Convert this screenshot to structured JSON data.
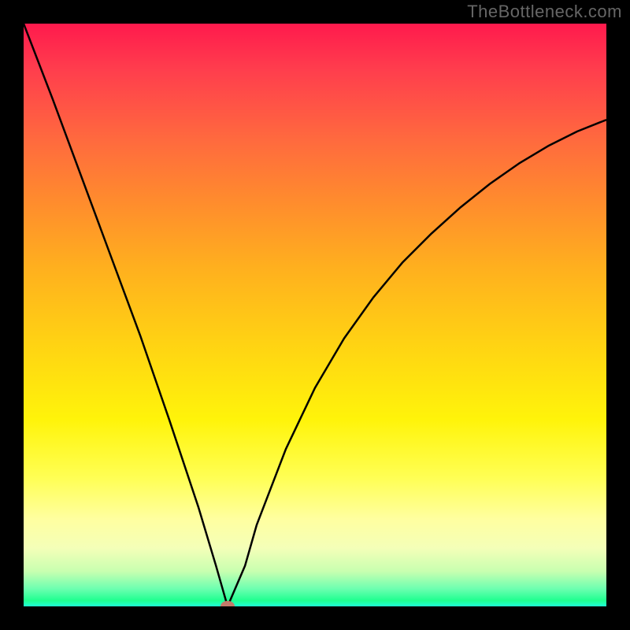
{
  "watermark": "TheBottleneck.com",
  "chart_data": {
    "type": "line",
    "title": "",
    "xlabel": "",
    "ylabel": "",
    "xlim": [
      0,
      100
    ],
    "ylim": [
      0,
      100
    ],
    "x": [
      0,
      5,
      10,
      15,
      20,
      25,
      30,
      33,
      35,
      38,
      40,
      45,
      50,
      55,
      60,
      65,
      70,
      75,
      80,
      85,
      90,
      95,
      100
    ],
    "values": [
      100,
      87,
      73.5,
      60,
      46.5,
      32,
      17,
      7,
      0,
      7,
      14,
      27,
      37.5,
      46,
      53,
      59,
      64,
      68.5,
      72.5,
      76,
      79,
      81.5,
      83.5
    ],
    "vertex": {
      "x": 35,
      "y": 0
    },
    "marker_color": "#c27a6a",
    "gradient_stops": [
      {
        "pos": 0,
        "color": "#ff1a4d"
      },
      {
        "pos": 8,
        "color": "#ff3e4d"
      },
      {
        "pos": 20,
        "color": "#ff6a3e"
      },
      {
        "pos": 30,
        "color": "#ff8a2e"
      },
      {
        "pos": 42,
        "color": "#ffb01e"
      },
      {
        "pos": 55,
        "color": "#ffd313"
      },
      {
        "pos": 68,
        "color": "#fff40a"
      },
      {
        "pos": 78,
        "color": "#ffff55"
      },
      {
        "pos": 85,
        "color": "#ffffa0"
      },
      {
        "pos": 90,
        "color": "#f4ffb8"
      },
      {
        "pos": 94,
        "color": "#c8ffb0"
      },
      {
        "pos": 97,
        "color": "#6cffb0"
      },
      {
        "pos": 99,
        "color": "#1fff90"
      },
      {
        "pos": 100,
        "color": "#1fffd5"
      }
    ]
  }
}
